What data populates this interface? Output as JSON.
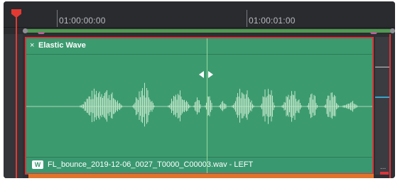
{
  "timeline": {
    "ruler": {
      "timecodes": [
        "01:00:00:00",
        "01:00:01:00"
      ]
    },
    "clip": {
      "title": "Elastic Wave",
      "close_glyph": "×",
      "filename": "FL_bounce_2019-12-06_0027_T0000_C00003.wav - LEFT",
      "audio_icon_glyph": "W",
      "more_glyph": "..."
    },
    "colors": {
      "clip_fill": "#3c9a6f",
      "clip_border": "#d8363a",
      "waveform": "#bfe6c8",
      "playhead": "#e23a33",
      "range_bar": "#4f9a52",
      "marker": "#d850b0",
      "orange_bar": "#e0742c"
    },
    "icons": {
      "playhead": "playhead-icon",
      "close": "close-icon",
      "audio_track": "audio-waveform-icon",
      "stretch_cursor": "stretch-cursor-icon",
      "range_marker": "marker-icon"
    }
  }
}
